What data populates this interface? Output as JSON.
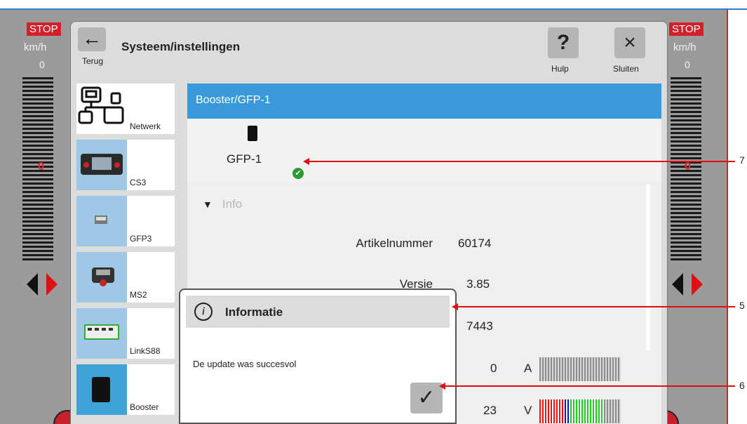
{
  "left_panel": {
    "stop_label": "STOP",
    "unit": "km/h",
    "speed": "0",
    "indicator": "0"
  },
  "right_panel": {
    "stop_label": "STOP",
    "unit": "km/h",
    "speed": "0",
    "indicator": "0"
  },
  "header": {
    "back_label": "Terug",
    "title": "Systeem/instellingen",
    "help_label": "Hulp",
    "close_label": "Sluiten",
    "help_glyph": "?",
    "close_glyph": "×",
    "back_glyph": "←"
  },
  "menu": [
    {
      "label": "Netwerk",
      "icon": "network-icon"
    },
    {
      "label": "CS3",
      "icon": "cs3-device-icon"
    },
    {
      "label": "GFP3",
      "icon": "gfp3-chip-icon"
    },
    {
      "label": "MS2",
      "icon": "ms2-controller-icon"
    },
    {
      "label": "LinkS88",
      "icon": "links88-module-icon"
    },
    {
      "label": "Booster",
      "icon": "booster-device-icon",
      "selected": true
    }
  ],
  "panel": {
    "header": "Booster/GFP-1",
    "device_name": "GFP-1",
    "info_label": "Info",
    "rows": [
      {
        "label": "Artikelnummer",
        "value": "60174"
      },
      {
        "label": "Versie",
        "value": "3.85"
      },
      {
        "label": "",
        "value": "7443"
      }
    ],
    "current": {
      "value": "0",
      "unit": "A",
      "level": 0
    },
    "voltage": {
      "value": "23",
      "unit": "V"
    }
  },
  "modal": {
    "title": "Informatie",
    "message": "De update was succesvol",
    "ok_glyph": "✓"
  },
  "callouts": [
    "7",
    "5",
    "6"
  ],
  "colors": {
    "accent": "#3a9ad9",
    "stop": "#d21f2a",
    "ok": "#2a9a35",
    "callout": "#dd1111"
  }
}
